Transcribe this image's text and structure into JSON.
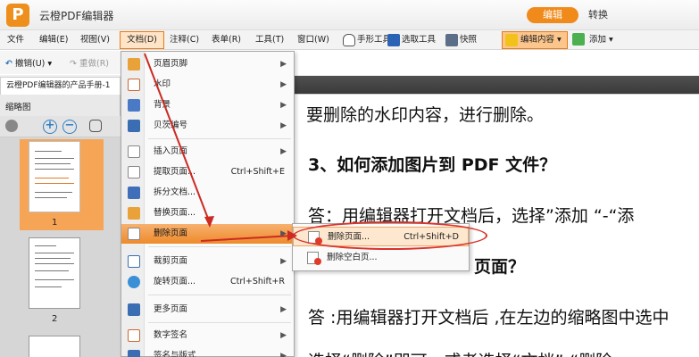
{
  "app": {
    "logo": "P",
    "title": "云橙PDF编辑器",
    "mode_edit": "编辑",
    "mode_convert": "转换"
  },
  "menubar": [
    "文件",
    "编辑(E)",
    "视图(V)",
    "文档(D)",
    "注释(C)",
    "表单(R)",
    "工具(T)",
    "窗口(W)"
  ],
  "toolbar": {
    "hand": "手形工具",
    "select": "选取工具",
    "snapshot": "快照",
    "edit_content": "编辑内容",
    "add": "添加",
    "undo": "撤销(U)",
    "redo": "重做(R)"
  },
  "tab": {
    "title": "云橙PDF编辑器的产品手册-1"
  },
  "sidebar": {
    "title": "缩略图",
    "pages": [
      "1",
      "2"
    ]
  },
  "document": {
    "lines": [
      "要删除的水印内容，进行删除。",
      "3、如何添加图片到  PDF  文件？",
      "答：用编辑器打开文档后，选择”添加 “-“添",
      "页面？",
      "答 :用编辑器打开文档后 ,在左边的缩略图中选中",
      "选择“删除”即可，或者选择“文档”-“删除"
    ]
  },
  "doc_menu": {
    "items": [
      {
        "label": "页眉页脚",
        "shortcut": "",
        "submenu": true
      },
      {
        "label": "水印",
        "shortcut": "",
        "submenu": true
      },
      {
        "label": "背景",
        "shortcut": "",
        "submenu": true
      },
      {
        "label": "贝茨编号",
        "shortcut": "",
        "submenu": true
      },
      {
        "label": "插入页面",
        "shortcut": "",
        "submenu": true
      },
      {
        "label": "提取页面...",
        "shortcut": "Ctrl+Shift+E",
        "submenu": false
      },
      {
        "label": "拆分文档...",
        "shortcut": "",
        "submenu": false
      },
      {
        "label": "替换页面...",
        "shortcut": "",
        "submenu": false
      },
      {
        "label": "删除页面",
        "shortcut": "",
        "submenu": true
      },
      {
        "label": "裁剪页面",
        "shortcut": "",
        "submenu": true
      },
      {
        "label": "旋转页面...",
        "shortcut": "Ctrl+Shift+R",
        "submenu": false
      },
      {
        "label": "更多页面",
        "shortcut": "",
        "submenu": true
      },
      {
        "label": "数字签名",
        "shortcut": "",
        "submenu": true
      },
      {
        "label": "签名与版式",
        "shortcut": "",
        "submenu": true
      }
    ]
  },
  "delete_submenu": {
    "items": [
      {
        "label": "删除页面...",
        "shortcut": "Ctrl+Shift+D"
      },
      {
        "label": "删除空白页..."
      }
    ]
  },
  "colors": {
    "accent": "#ef8a1b",
    "highlight_ring": "#d9332b",
    "arrow": "#cc2a22"
  }
}
